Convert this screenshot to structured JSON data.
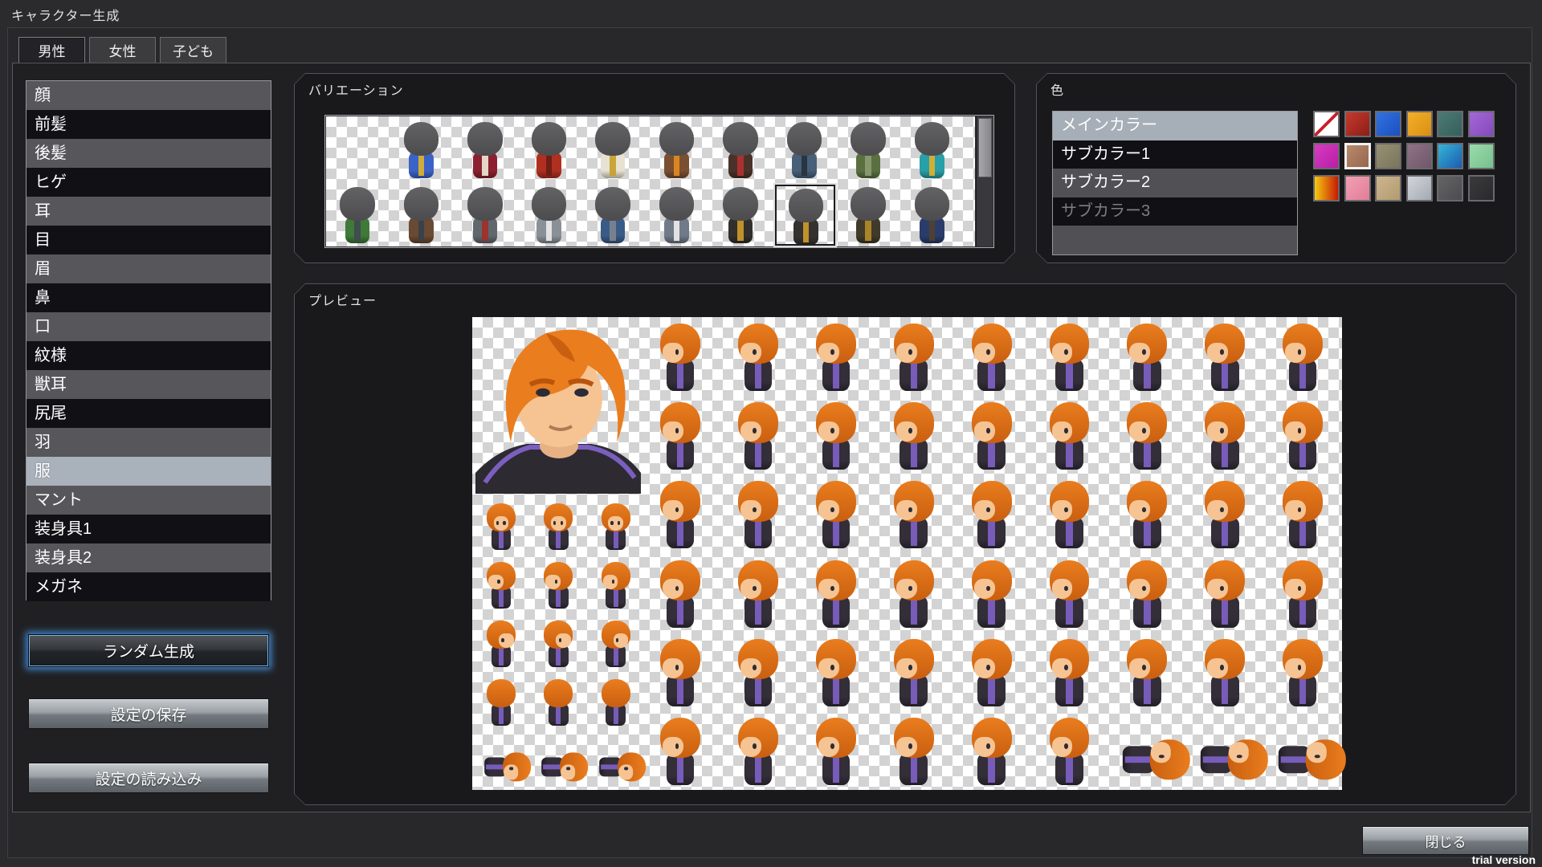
{
  "window": {
    "title": "キャラクター生成",
    "trial": "trial version"
  },
  "tabs": [
    {
      "label": "男性",
      "selected": true
    },
    {
      "label": "女性",
      "selected": false
    },
    {
      "label": "子ども",
      "selected": false
    }
  ],
  "parts_list": [
    {
      "label": "顔"
    },
    {
      "label": "前髪"
    },
    {
      "label": "後髪"
    },
    {
      "label": "ヒゲ"
    },
    {
      "label": "耳"
    },
    {
      "label": "目"
    },
    {
      "label": "眉"
    },
    {
      "label": "鼻"
    },
    {
      "label": "口"
    },
    {
      "label": "紋様"
    },
    {
      "label": "獣耳"
    },
    {
      "label": "尻尾"
    },
    {
      "label": "羽"
    },
    {
      "label": "服",
      "selected": true
    },
    {
      "label": "マント"
    },
    {
      "label": "装身具1"
    },
    {
      "label": "装身具2"
    },
    {
      "label": "メガネ"
    }
  ],
  "buttons": {
    "random": "ランダム生成",
    "save": "設定の保存",
    "load": "設定の読み込み",
    "close": "閉じる"
  },
  "variation": {
    "label": "バリエーション",
    "selected_cell": {
      "row": 1,
      "col": 7
    },
    "mannequin_head": [
      "#636366",
      "#4c4c4f"
    ],
    "rows": [
      [
        null,
        {
          "main": "#3a63c8",
          "accent": "#d8b031"
        },
        {
          "main": "#8c2030",
          "accent": "#e8e0d0"
        },
        {
          "main": "#b03020",
          "accent": "#6e1e14"
        },
        {
          "main": "#e8e2d2",
          "accent": "#c8a030"
        },
        {
          "main": "#7a5030",
          "accent": "#e08820"
        },
        {
          "main": "#4a3228",
          "accent": "#b03030"
        },
        {
          "main": "#48607a",
          "accent": "#28333d"
        },
        {
          "main": "#5a7040",
          "accent": "#8a9a70"
        },
        {
          "main": "#28a0a8",
          "accent": "#d8b031"
        }
      ],
      [
        {
          "main": "#3f7a38",
          "accent": "#404a50"
        },
        {
          "main": "#6a4a32",
          "accent": "#38404a"
        },
        {
          "main": "#60686e",
          "accent": "#a03028"
        },
        {
          "main": "#8a9098",
          "accent": "#e8e8e8"
        },
        {
          "main": "#3a5a88",
          "accent": "#7a848c"
        },
        {
          "main": "#707a88",
          "accent": "#e8e8e8"
        },
        {
          "main": "#32302e",
          "accent": "#c8982a"
        },
        {
          "main": "#343230",
          "accent": "#c8982a"
        },
        {
          "main": "#403a2a",
          "accent": "#b08828"
        },
        {
          "main": "#2a3c6a",
          "accent": "#504030"
        }
      ]
    ]
  },
  "colors_panel": {
    "label": "色",
    "targets": [
      {
        "label": "メインカラー",
        "state": "selected"
      },
      {
        "label": "サブカラー1",
        "state": "normal"
      },
      {
        "label": "サブカラー2",
        "state": "normal"
      },
      {
        "label": "サブカラー3",
        "state": "disabled"
      },
      {
        "label": "",
        "state": "empty"
      }
    ],
    "selected_swatch": {
      "row": 1,
      "col": 1
    },
    "swatches": [
      [
        {
          "none": true
        },
        {
          "c1": "#c53b2e",
          "c2": "#8c1d16"
        },
        {
          "c1": "#3173e0",
          "c2": "#1b4fc0"
        },
        {
          "c1": "#f3b02a",
          "c2": "#d98f12"
        },
        {
          "c1": "#4b7a74",
          "c2": "#35605c"
        },
        {
          "c1": "#a468d6",
          "c2": "#8549bd"
        }
      ],
      [
        {
          "c1": "#d63bc0",
          "c2": "#b81fa6"
        },
        {
          "c1": "#b98a6d",
          "c2": "#95664c"
        },
        {
          "c1": "#979173",
          "c2": "#7a745c"
        },
        {
          "c1": "#8f7386",
          "c2": "#6f5669"
        },
        {
          "c1": "#35b5d6",
          "c2": "#1b5cb0"
        },
        {
          "c1": "#9adbab",
          "c2": "#76c18d"
        }
      ],
      [
        {
          "c1": "#f5c912",
          "c2": "#c81a04",
          "dir": "90deg"
        },
        {
          "c1": "#f0a0b4",
          "c2": "#e27d96"
        },
        {
          "c1": "#cdb68d",
          "c2": "#b29a71"
        },
        {
          "c1": "#d3d6db",
          "c2": "#a3a9b1"
        },
        {
          "c1": "#646466",
          "c2": "#4c4c4e"
        },
        {
          "c1": "#3a3a3c",
          "c2": "#2a2a2c"
        }
      ]
    ]
  },
  "preview": {
    "label": "プレビュー",
    "character": {
      "hair": "#ea7d1e",
      "hair_dark": "#c95f10",
      "skin": "#f6c493",
      "outfit": "#332e38",
      "outfit_trim": "#7b5fc0"
    },
    "walk_grid": {
      "cols": 3,
      "rows": [
        "down",
        "left",
        "right",
        "up",
        "lie"
      ]
    },
    "battler_grid": {
      "cols": 9,
      "rows": 6,
      "lying_cells": [
        [
          5,
          6
        ],
        [
          5,
          7
        ],
        [
          5,
          8
        ]
      ]
    }
  }
}
